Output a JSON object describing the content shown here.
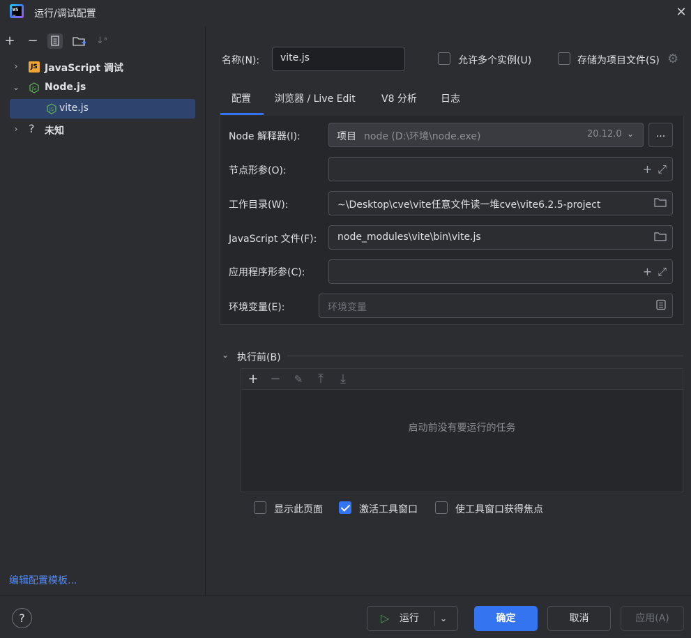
{
  "window": {
    "title": "运行/调试配置"
  },
  "left": {
    "toolbar": [
      "add-icon",
      "remove-icon",
      "copy-icon",
      "new-folder-icon",
      "sort-icon"
    ],
    "tree": [
      {
        "label": "JavaScript 调试",
        "icon": "js-icon",
        "expanded": false
      },
      {
        "label": "Node.js",
        "icon": "nodejs-icon",
        "expanded": true
      },
      {
        "label": "vite.js",
        "icon": "nodejs-icon",
        "selected": true
      },
      {
        "label": "未知",
        "icon": "question-icon",
        "expanded": false
      }
    ],
    "edit_templates": "编辑配置模板..."
  },
  "form": {
    "name_label": "名称(N):",
    "name_value": "vite.js",
    "allow_multiple": {
      "label": "允许多个实例(U)",
      "checked": false
    },
    "store_as_project": {
      "label": "存储为项目文件(S)",
      "checked": false
    },
    "tabs": [
      "配置",
      "浏览器 / Live Edit",
      "V8 分析",
      "日志"
    ],
    "active_tab": "配置",
    "interpreter": {
      "label": "Node 解释器(I):",
      "kind": "项目",
      "path": "node (D:\\环境\\node.exe)",
      "version": "20.12.0",
      "more": "..."
    },
    "node_params_label": "节点形参(O):",
    "workdir": {
      "label": "工作目录(W):",
      "value": "~\\Desktop\\cve\\vite任意文件读一堆cve\\vite6.2.5-project"
    },
    "js_file": {
      "label": "JavaScript 文件(F):",
      "value": "node_modules\\vite\\bin\\vite.js"
    },
    "app_params_label": "应用程序形参(C):",
    "env": {
      "label": "环境变量(E):",
      "placeholder": "环境变量"
    }
  },
  "before_launch": {
    "title": "执行前(B)",
    "empty_text": "启动前没有要运行的任务",
    "options": [
      {
        "label": "显示此页面",
        "checked": false
      },
      {
        "label": "激活工具窗口",
        "checked": true
      },
      {
        "label": "使工具窗口获得焦点",
        "checked": false
      }
    ]
  },
  "buttons": {
    "help": "?",
    "run": "运行",
    "ok": "确定",
    "cancel": "取消",
    "apply": "应用(A)"
  },
  "colors": {
    "accent": "#3574f0",
    "bg": "#2b2d30",
    "selected_row": "#2e436e"
  }
}
